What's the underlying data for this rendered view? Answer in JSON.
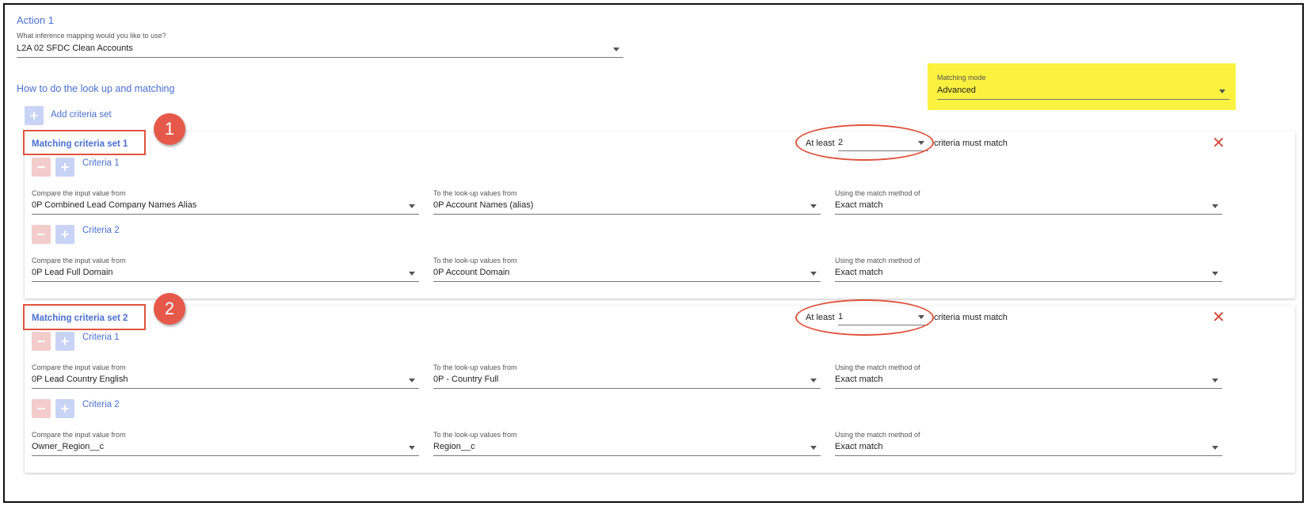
{
  "action": {
    "title": "Action 1",
    "mapping_label": "What inference mapping would you like to use?",
    "mapping_value": "L2A 02 SFDC Clean Accounts"
  },
  "lookup": {
    "title": "How to do the look up and matching",
    "add_criteria_label": "Add criteria set"
  },
  "matching_mode": {
    "label": "Matching mode",
    "value": "Advanced"
  },
  "sets": [
    {
      "title": "Matching criteria set 1",
      "badge": "1",
      "at_least_label": "At least",
      "at_least_value": "2",
      "must_match_label": "criteria must match",
      "criteria": [
        {
          "title": "Criteria 1",
          "input_label": "Compare the input value from",
          "input_value": "0P Combined Lead Company Names Alias",
          "lookup_label": "To the look-up values from",
          "lookup_value": "0P Account Names (alias)",
          "method_label": "Using the match method of",
          "method_value": "Exact match"
        },
        {
          "title": "Criteria 2",
          "input_label": "Compare the input value from",
          "input_value": "0P Lead Full Domain",
          "lookup_label": "To the look-up values from",
          "lookup_value": "0P Account Domain",
          "method_label": "Using the match method of",
          "method_value": "Exact match"
        }
      ]
    },
    {
      "title": "Matching criteria set 2",
      "badge": "2",
      "at_least_label": "At least",
      "at_least_value": "1",
      "must_match_label": "criteria must match",
      "criteria": [
        {
          "title": "Criteria 1",
          "input_label": "Compare the input value from",
          "input_value": "0P Lead Country English",
          "lookup_label": "To the look-up values from",
          "lookup_value": "0P - Country Full",
          "method_label": "Using the match method of",
          "method_value": "Exact match"
        },
        {
          "title": "Criteria 2",
          "input_label": "Compare the input value from",
          "input_value": "Owner_Region__c",
          "lookup_label": "To the look-up values from",
          "lookup_value": "Region__c",
          "method_label": "Using the match method of",
          "method_value": "Exact match"
        }
      ]
    }
  ],
  "colors": {
    "accent_blue": "#4a6fd0",
    "annotation_red": "#e0533d",
    "highlight_yellow": "#fbf240"
  }
}
